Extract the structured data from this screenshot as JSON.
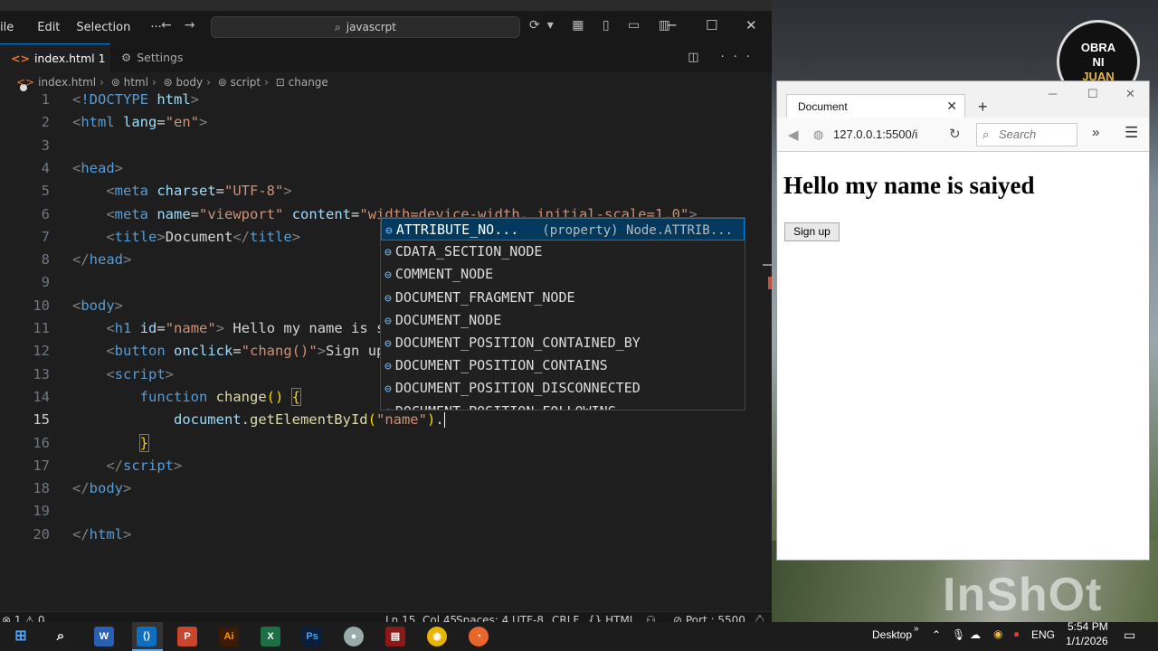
{
  "vscode": {
    "menu": [
      "ile",
      "Edit",
      "Selection",
      "···"
    ],
    "command_center": "javascrpt",
    "tabs": [
      {
        "label": "index.html 1",
        "modified": true
      },
      {
        "label": "Settings"
      }
    ],
    "breadcrumb": [
      "index.html",
      "html",
      "body",
      "script",
      "change"
    ],
    "line_numbers": [
      "1",
      "2",
      "3",
      "4",
      "5",
      "6",
      "7",
      "8",
      "9",
      "10",
      "11",
      "12",
      "13",
      "14",
      "15",
      "16",
      "17",
      "18",
      "19",
      "20"
    ],
    "current_line": "15",
    "suggestions": [
      {
        "label": "ATTRIBUTE_NO...",
        "detail": "(property) Node.ATTRIB..."
      },
      {
        "label": "CDATA_SECTION_NODE"
      },
      {
        "label": "COMMENT_NODE"
      },
      {
        "label": "DOCUMENT_FRAGMENT_NODE"
      },
      {
        "label": "DOCUMENT_NODE"
      },
      {
        "label": "DOCUMENT_POSITION_CONTAINED_BY"
      },
      {
        "label": "DOCUMENT_POSITION_CONTAINS"
      },
      {
        "label": "DOCUMENT_POSITION_DISCONNECTED"
      },
      {
        "label": "DOCUMENT_POSITION_FOLLOWING"
      }
    ],
    "status": {
      "problems": "1",
      "warnings": "0",
      "position": "Ln 15, Col 45",
      "spaces": "Spaces: 4",
      "encoding": "UTF-8",
      "eol": "CRLF",
      "language": "HTML",
      "port": "Port : 5500"
    }
  },
  "browser": {
    "tab_title": "Document",
    "url": "127.0.0.1:5500/i",
    "search_placeholder": "Search",
    "heading": "Hello my name is saiyed",
    "button_label": "Sign up"
  },
  "badge": {
    "line1": "OBRA",
    "line2": "NI",
    "line3": "JUAN"
  },
  "watermark": "InShOt",
  "taskbar": {
    "desktop_label": "Desktop",
    "language": "ENG",
    "time": "5:54 PM",
    "date": "1/1/2026"
  },
  "colors": {
    "accent": "#0078d4",
    "editor_bg": "#1e1e1e",
    "suggest_selected": "#04395e"
  }
}
